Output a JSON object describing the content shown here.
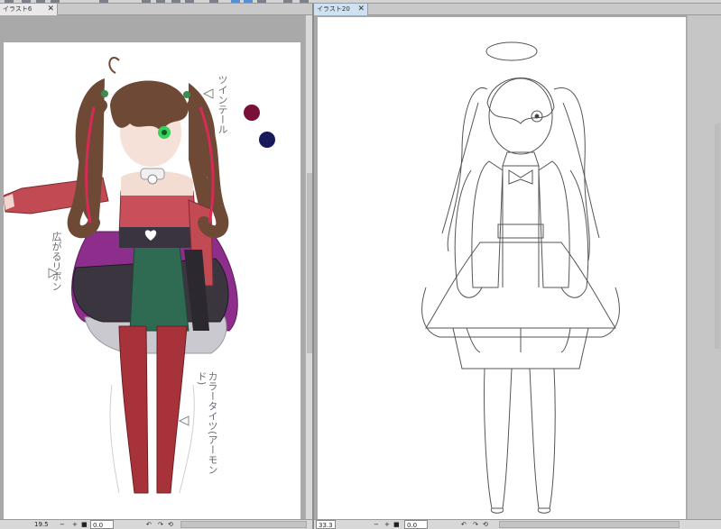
{
  "tabs": {
    "left": {
      "title": "イラスト6",
      "close": "✕"
    },
    "right": {
      "title": "イラスト20",
      "close": "✕"
    }
  },
  "annotations": {
    "twintail": "ツインテール",
    "ribbon": "広がるリボン",
    "tights": "カラータイツ(アーモンド)"
  },
  "swatches": {
    "color1": "#7a0f37",
    "color2": "#17195a"
  },
  "status": {
    "left": {
      "zoom": "19.5",
      "minus": "−",
      "plus": "+",
      "angle": "0.0"
    },
    "right": {
      "zoom": "33.3",
      "minus": "−",
      "plus": "+",
      "angle": "0.0"
    }
  },
  "icons": {
    "zoom_square": "■",
    "rotate_left": "↶",
    "rotate_right": "↷",
    "reset": "⟲"
  }
}
